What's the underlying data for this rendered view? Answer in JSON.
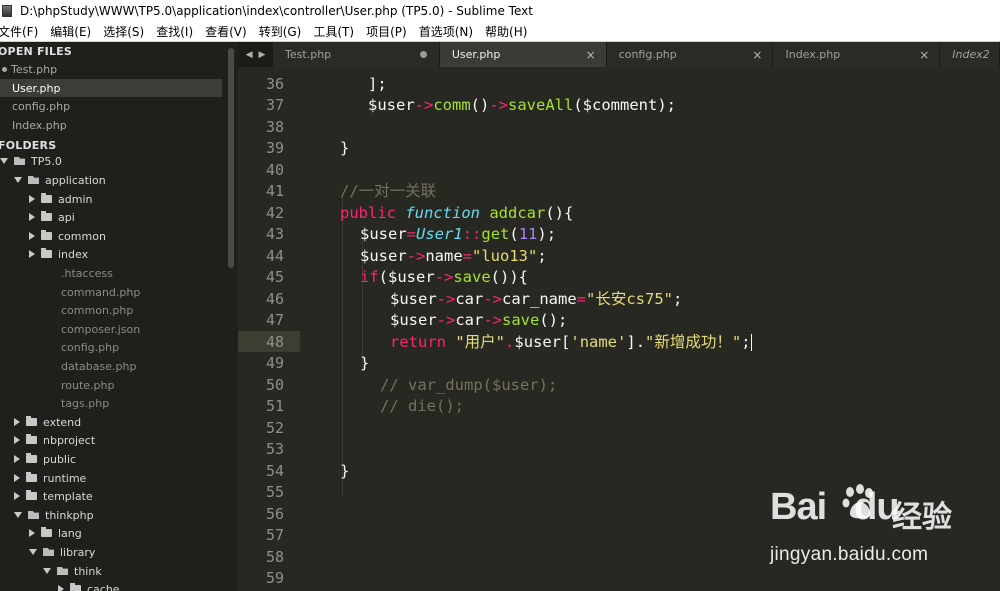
{
  "window": {
    "title": "D:\\phpStudy\\WWW\\TP5.0\\application\\index\\controller\\User.php (TP5.0) - Sublime Text"
  },
  "menu": [
    "文件(F)",
    "编辑(E)",
    "选择(S)",
    "查找(I)",
    "查看(V)",
    "转到(G)",
    "工具(T)",
    "项目(P)",
    "首选项(N)",
    "帮助(H)"
  ],
  "sidebar": {
    "open_files_heading": "OPEN FILES",
    "open_files": [
      "Test.php",
      "User.php",
      "config.php",
      "Index.php"
    ],
    "folders_heading": "FOLDERS",
    "tree": [
      "TP5.0",
      "application",
      "admin",
      "api",
      "common",
      "index",
      ".htaccess",
      "command.php",
      "common.php",
      "composer.json",
      "config.php",
      "database.php",
      "route.php",
      "tags.php",
      "extend",
      "nbproject",
      "public",
      "runtime",
      "template",
      "thinkphp",
      "lang",
      "library",
      "think",
      "cache"
    ]
  },
  "tabs": [
    "Test.php",
    "User.php",
    "config.php",
    "Index.php",
    "Index2"
  ],
  "editor": {
    "line_numbers": [
      "36",
      "37",
      "38",
      "39",
      "40",
      "41",
      "42",
      "43",
      "44",
      "45",
      "46",
      "47",
      "48",
      "49",
      "50",
      "51",
      "52",
      "53",
      "54",
      "55",
      "56",
      "57",
      "58",
      "59"
    ],
    "lines": {
      "l36": "];",
      "l37_a": "$user",
      "l37_b": "->",
      "l37_c": "comm",
      "l37_d": "()",
      "l37_e": "->",
      "l37_f": "saveAll",
      "l37_g": "($comment);",
      "l39": "}",
      "l41": "//一对一关联",
      "l42_a": "public",
      "l42_b": "function",
      "l42_c": "addcar",
      "l42_d": "(){",
      "l43_a": "$user",
      "l43_b": "=",
      "l43_c": "User1",
      "l43_d": "::",
      "l43_e": "get",
      "l43_f": "(",
      "l43_g": "11",
      "l43_h": ");",
      "l44_a": "$user",
      "l44_b": "->",
      "l44_c": "name",
      "l44_d": "=",
      "l44_e": "\"luo13\"",
      "l44_f": ";",
      "l45_a": "if",
      "l45_b": "($user",
      "l45_c": "->",
      "l45_d": "save",
      "l45_e": "()){",
      "l46_a": "$user",
      "l46_b": "->",
      "l46_c": "car",
      "l46_d": "->",
      "l46_e": "car_name",
      "l46_f": "=",
      "l46_g": "\"长安cs75\"",
      "l46_h": ";",
      "l47_a": "$user",
      "l47_b": "->",
      "l47_c": "car",
      "l47_d": "->",
      "l47_e": "save",
      "l47_f": "();",
      "l48_a": "return",
      "l48_b": "\"用户\"",
      "l48_c": ".",
      "l48_d": "$user[",
      "l48_e": "'name'",
      "l48_f": "].",
      "l48_g": "\"新增成功！\"",
      "l48_h": ";",
      "l49": "}",
      "l50": "// var_dump($user);",
      "l51": "// die();",
      "l54": "}"
    }
  },
  "watermark": {
    "logo": "Bai",
    "logo2": "du",
    "cn": "经验",
    "url": "jingyan.baidu.com"
  }
}
